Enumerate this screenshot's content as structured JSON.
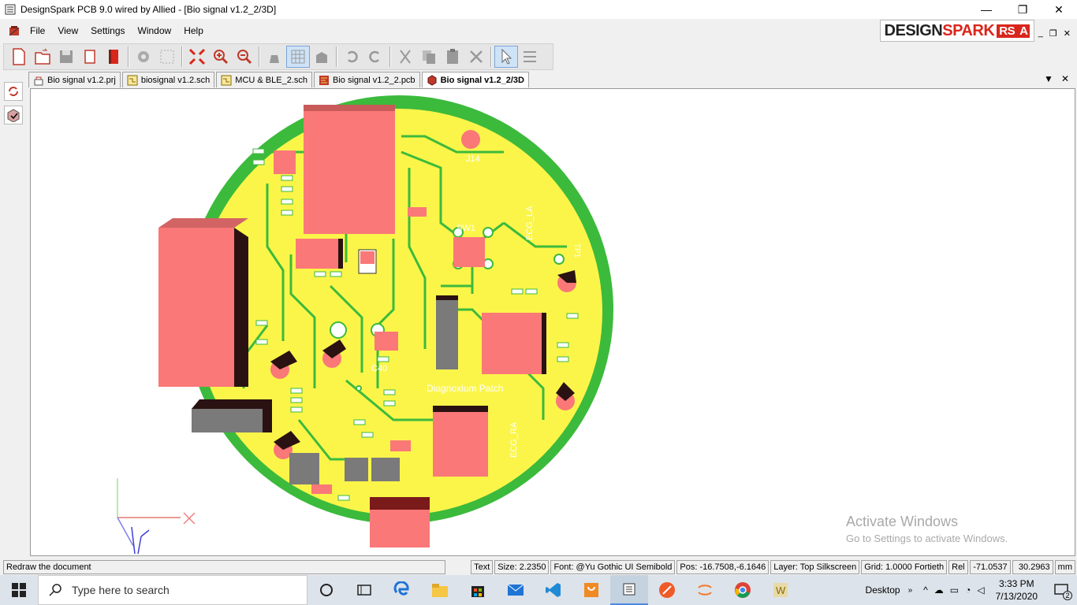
{
  "window": {
    "title": "DesignSpark PCB 9.0 wired by Allied - [Bio signal v1.2_2/3D]",
    "minimize": "—",
    "maximize": "❐",
    "close": "✕"
  },
  "menu": {
    "items": [
      "File",
      "View",
      "Settings",
      "Window",
      "Help"
    ]
  },
  "brand": {
    "text_dark": "DESIGN",
    "text_red": "SPARK",
    "badge": "RS"
  },
  "mdi": {
    "minimize": "_",
    "restore": "❐",
    "close": "✕"
  },
  "toolbar": {
    "icons": [
      "new-file",
      "open-file",
      "save",
      "save-all",
      "library",
      "settings-gear",
      "grid-settings",
      "zoom-fit",
      "zoom-in",
      "zoom-out",
      "pan",
      "grid-toggle",
      "layer-toggle",
      "undo",
      "redo",
      "cut",
      "copy",
      "paste",
      "delete",
      "select",
      "properties"
    ]
  },
  "tabs": [
    {
      "label": "Bio signal v1.2.prj",
      "icon": "project-icon",
      "active": false
    },
    {
      "label": "biosignal v1.2.sch",
      "icon": "schematic-icon",
      "active": false
    },
    {
      "label": "MCU & BLE_2.sch",
      "icon": "schematic-icon",
      "active": false
    },
    {
      "label": "Bio signal v1.2_2.pcb",
      "icon": "pcb-icon",
      "active": false
    },
    {
      "label": "Bio signal v1.2_2/3D",
      "icon": "3d-icon",
      "active": true
    }
  ],
  "tab_controls": {
    "dropdown": "▼",
    "close": "✕"
  },
  "board": {
    "label": "Diagnoxium Patch",
    "silkscreen": [
      "J14",
      "SW1",
      "ECG_LA",
      "ECG_RA",
      "C40",
      "TP1"
    ],
    "colors": {
      "outline": "#3cba3c",
      "surface": "#fbf54a",
      "component": "#fa7878",
      "ic": "#7a7a7a"
    }
  },
  "status": {
    "message": "Redraw the document",
    "mode": "Text",
    "size": "Size: 2.2350",
    "font": "Font: @Yu Gothic UI Semibold",
    "pos": "Pos: -16.7508,-6.1646",
    "layer": "Layer: Top Silkscreen",
    "grid": "Grid: 1.0000 Fortieth",
    "rel": "Rel",
    "relx": "-71.0537",
    "rely": "30.2963",
    "units": "mm"
  },
  "activate": {
    "line1": "Activate Windows",
    "line2": "Go to Settings to activate Windows."
  },
  "taskbar": {
    "search_placeholder": "Type here to search",
    "desktop_label": "Desktop",
    "time": "3:33 PM",
    "date": "7/13/2020",
    "notifications": "2"
  }
}
